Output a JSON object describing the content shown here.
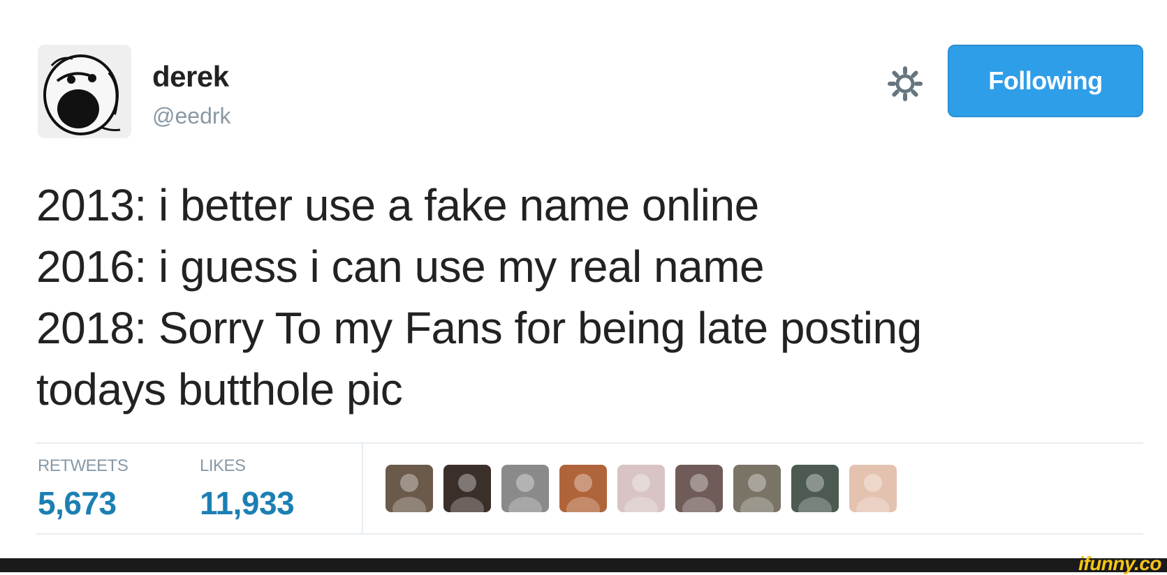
{
  "author": {
    "name": "derek",
    "handle": "@eedrk"
  },
  "actions": {
    "follow_label": "Following",
    "settings_icon": "gear-icon"
  },
  "tweet": {
    "lines": [
      "2013: i better use a fake name online",
      "2016: i guess i can use my real name",
      "2018: Sorry To my Fans for being late posting",
      "todays butthole pic"
    ]
  },
  "stats": {
    "retweets_label": "RETWEETS",
    "retweets_value": "5,673",
    "likes_label": "LIKES",
    "likes_value": "11,933"
  },
  "likers": [
    {
      "icon": "user-avatar-icon",
      "color": "#6b5a4a"
    },
    {
      "icon": "user-avatar-icon",
      "color": "#3b2f2a"
    },
    {
      "icon": "user-avatar-icon",
      "color": "#8a8a8a"
    },
    {
      "icon": "user-avatar-icon",
      "color": "#b0643a"
    },
    {
      "icon": "user-avatar-icon",
      "color": "#d8c4c4"
    },
    {
      "icon": "user-avatar-icon",
      "color": "#6f5b57"
    },
    {
      "icon": "user-avatar-icon",
      "color": "#7a7466"
    },
    {
      "icon": "user-avatar-icon",
      "color": "#4c5a52"
    },
    {
      "icon": "user-avatar-icon",
      "color": "#e3c2b0"
    }
  ],
  "watermark": "ifunny.co",
  "colors": {
    "follow_button": "#2f9ee8",
    "stat_value": "#1c7fb3",
    "muted_text": "#8899a6"
  }
}
